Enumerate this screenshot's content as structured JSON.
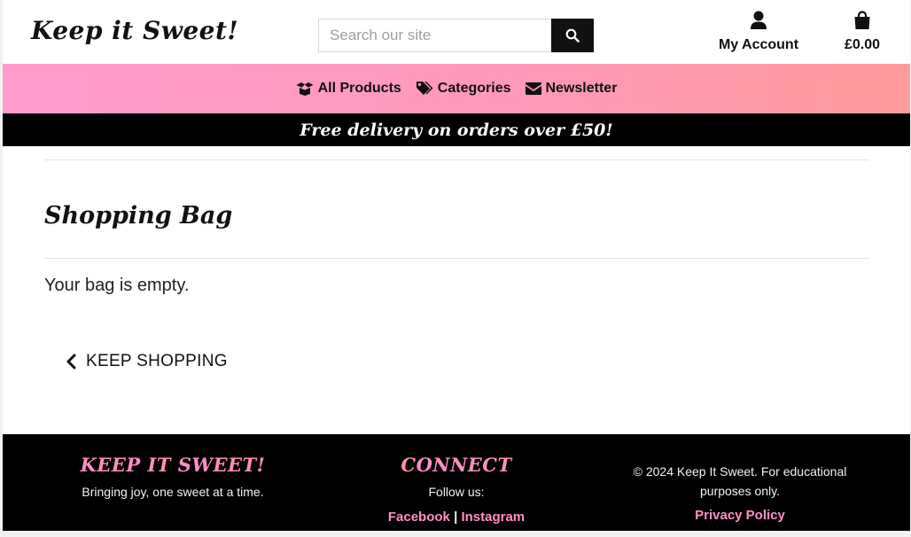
{
  "header": {
    "logo": "Keep it Sweet!",
    "search": {
      "placeholder": "Search our site",
      "value": ""
    },
    "account_label": "My Account",
    "bag_total": "£0.00"
  },
  "nav": {
    "items": [
      {
        "label": "All Products",
        "icon": "box-open-icon"
      },
      {
        "label": "Categories",
        "icon": "tags-icon"
      },
      {
        "label": "Newsletter",
        "icon": "envelope-icon"
      }
    ]
  },
  "promo": {
    "text": "Free delivery on orders over £50!"
  },
  "main": {
    "title": "Shopping Bag",
    "empty_message": "Your bag is empty.",
    "keep_shopping_label": "KEEP SHOPPING"
  },
  "footer": {
    "brand": {
      "heading": "KEEP IT SWEET!",
      "tagline": "Bringing joy, one sweet at a time."
    },
    "connect": {
      "heading": "CONNECT",
      "follow_label": "Follow us:",
      "links": [
        "Facebook",
        "Instagram"
      ],
      "separator": "|"
    },
    "legal": {
      "copyright": "© 2024 Keep It Sweet. For educational purposes only.",
      "privacy_label": "Privacy Policy"
    }
  },
  "colors": {
    "accent_pink": "#ff8fc0",
    "nav_gradient_start": "#ff9ccd",
    "nav_gradient_end": "#ff9b9b",
    "dark": "#000000"
  }
}
